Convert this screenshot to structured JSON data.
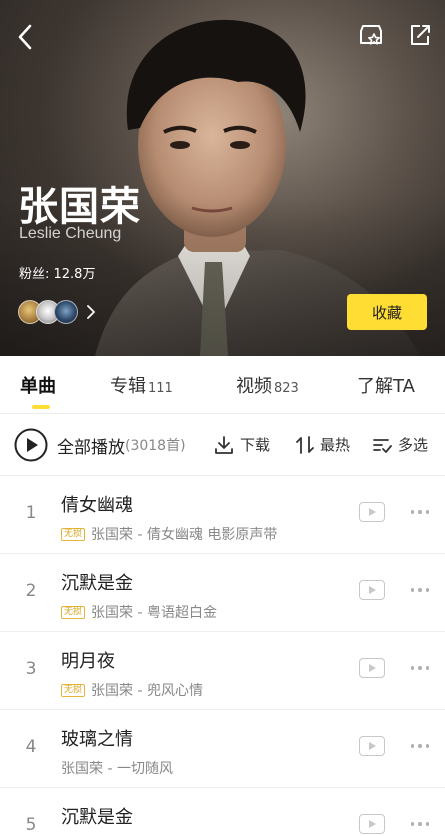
{
  "artist": {
    "name": "张国荣",
    "name_en": "Leslie Cheung",
    "fans": "粉丝: 12.8万",
    "collect_label": "收藏"
  },
  "icons": {
    "back": "back-arrow-icon",
    "favorite": "star-badge-icon",
    "share": "share-icon"
  },
  "tabs": [
    {
      "label": "单曲",
      "count": "",
      "active": true
    },
    {
      "label": "专辑",
      "count": "111",
      "active": false
    },
    {
      "label": "视频",
      "count": "823",
      "active": false
    },
    {
      "label": "了解TA",
      "count": "",
      "active": false
    }
  ],
  "actions": {
    "play_all": "全部播放",
    "play_all_count": "(3018首)",
    "download": "下载",
    "sort": "最热",
    "multi_select": "多选"
  },
  "songs": [
    {
      "index": "1",
      "title": "倩女幽魂",
      "badge": "无损",
      "subtitle": "张国荣 - 倩女幽魂 电影原声带"
    },
    {
      "index": "2",
      "title": "沉默是金",
      "badge": "无损",
      "subtitle": "张国荣 - 粤语超白金"
    },
    {
      "index": "3",
      "title": "明月夜",
      "badge": "无损",
      "subtitle": "张国荣 - 兜风心情"
    },
    {
      "index": "4",
      "title": "玻璃之情",
      "badge": "",
      "subtitle": "张国荣 - 一切随风"
    },
    {
      "index": "5",
      "title": "沉默是金",
      "badge": "",
      "subtitle": ""
    }
  ],
  "colors": {
    "accent": "#ffdd33",
    "badge": "#d9a51e"
  }
}
